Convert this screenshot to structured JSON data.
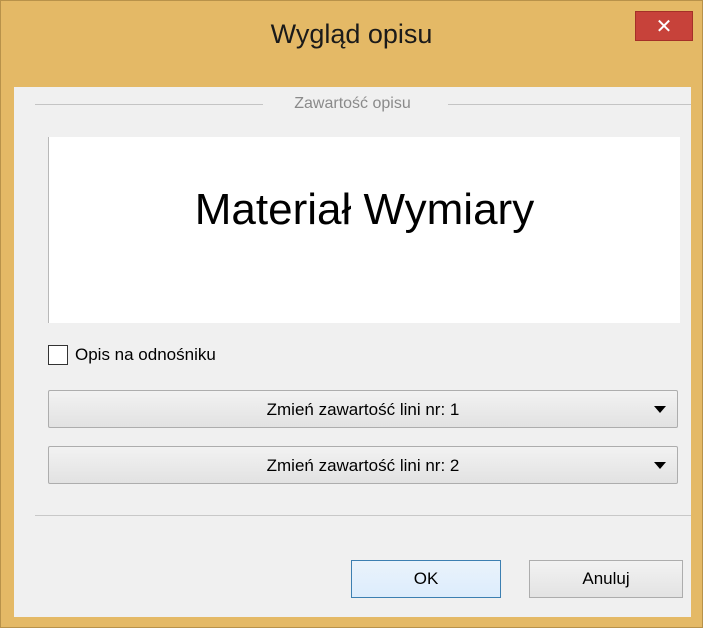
{
  "window": {
    "title": "Wygląd opisu",
    "close_glyph": "✕"
  },
  "group": {
    "title": "Zawartość opisu"
  },
  "preview": {
    "text": "Materiał Wymiary"
  },
  "options": {
    "label_on_leader": {
      "label": "Opis na odnośniku",
      "checked": false
    }
  },
  "line_selectors": [
    {
      "label": "Zmień zawartość lini nr: 1"
    },
    {
      "label": "Zmień zawartość lini nr: 2"
    }
  ],
  "buttons": {
    "ok_label": "OK",
    "cancel_label": "Anuluj"
  },
  "colors": {
    "frame": "#e4b966",
    "close_button": "#c7423a",
    "client_bg": "#f0f0f0",
    "default_button_border": "#3c7fb1"
  }
}
